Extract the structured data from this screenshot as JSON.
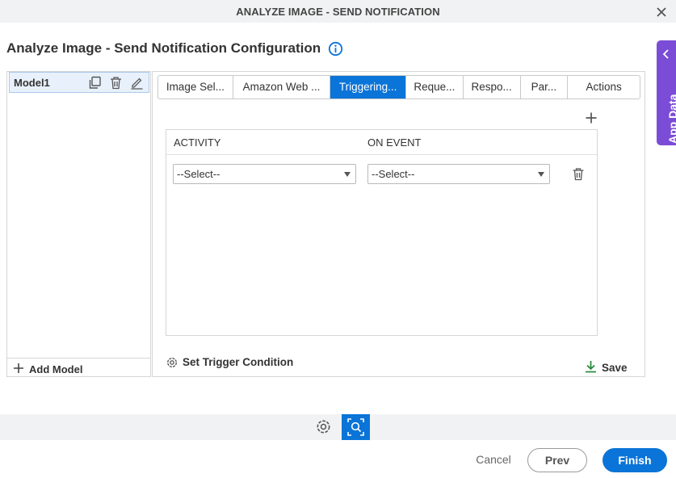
{
  "window": {
    "title": "ANALYZE IMAGE - SEND NOTIFICATION"
  },
  "page": {
    "heading": "Analyze Image - Send Notification Configuration"
  },
  "app_data": {
    "label": "App Data"
  },
  "models": {
    "items": [
      {
        "label": "Model1"
      }
    ],
    "add_label": "Add Model"
  },
  "tabs": [
    {
      "label": "Image Sel...",
      "active": false
    },
    {
      "label": "Amazon Web ...",
      "active": false
    },
    {
      "label": "Triggering...",
      "active": true
    },
    {
      "label": "Reque...",
      "active": false
    },
    {
      "label": "Respo...",
      "active": false
    },
    {
      "label": "Par...",
      "active": false
    },
    {
      "label": "Actions",
      "active": false
    }
  ],
  "trigger_table": {
    "headers": {
      "activity": "ACTIVITY",
      "on_event": "ON EVENT"
    },
    "rows": [
      {
        "activity": "--Select--",
        "on_event": "--Select--"
      }
    ]
  },
  "actions": {
    "set_trigger_condition": "Set Trigger Condition",
    "save": "Save"
  },
  "footer": {
    "cancel": "Cancel",
    "prev": "Prev",
    "finish": "Finish"
  },
  "colors": {
    "accent": "#0a74d8",
    "app_data": "#7b4dd6",
    "save_icon": "#2e8b3e"
  }
}
